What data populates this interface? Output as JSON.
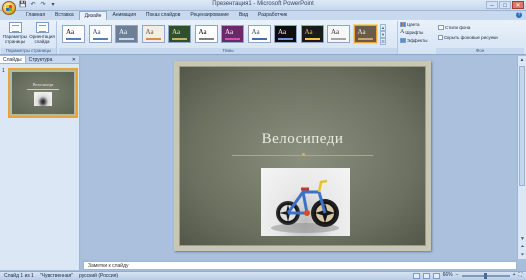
{
  "app": {
    "title": "Презентация1 - Microsoft PowerPoint",
    "window_controls": [
      "–",
      "□",
      "✕"
    ]
  },
  "quick_access": [
    "💾",
    "↶",
    "↷",
    "▾"
  ],
  "ribbon": {
    "tabs": [
      "Главная",
      "Вставка",
      "Дизайн",
      "Анимация",
      "Показ слайдов",
      "Рецензирование",
      "Вид",
      "Разработчик"
    ],
    "active_tab": "Дизайн",
    "page_setup": {
      "group_label": "Параметры страницы",
      "buttons": [
        "Параметры страницы",
        "Ориентация слайда"
      ]
    },
    "themes": {
      "group_label": "Темы",
      "items": [
        {
          "label": "Aa",
          "bg": "#ffffff",
          "fg": "#000000",
          "bars": "#4f81bd"
        },
        {
          "label": "Aa",
          "bg": "#ffffff",
          "fg": "#1f497d",
          "bars": "#4f81bd"
        },
        {
          "label": "Aa",
          "bg": "#6d7f97",
          "fg": "#ffffff",
          "bars": "#c9d6e5"
        },
        {
          "label": "Aa",
          "bg": "#f2eee4",
          "fg": "#7b4d2e",
          "bars": "#d58f4a"
        },
        {
          "label": "Aa",
          "bg": "#2f4f2f",
          "fg": "#f0e6b0",
          "bars": "#c9b25a"
        },
        {
          "label": "Aa",
          "bg": "#ffffff",
          "fg": "#000000",
          "bars": "#7f7f7f"
        },
        {
          "label": "Aa",
          "bg": "#6a2a6a",
          "fg": "#ffffff",
          "bars": "#d04fb0"
        },
        {
          "label": "Aa",
          "bg": "#ffffff",
          "fg": "#2c4b70",
          "bars": "#3b6eb0"
        },
        {
          "label": "Aa",
          "bg": "#0d0d0d",
          "fg": "#ffffff",
          "bars": "#6a9be0"
        },
        {
          "label": "Aa",
          "bg": "#1a1a1a",
          "fg": "#f6c24a",
          "bars": "#f6c24a"
        },
        {
          "label": "Aa",
          "bg": "#f7f7f7",
          "fg": "#2c2c2c",
          "bars": "#a5a5a5"
        },
        {
          "label": "Aa",
          "bg": "#6b5a48",
          "fg": "#f3ead8",
          "bars": "#c9a46a"
        }
      ],
      "selected_index": 11
    },
    "theme_cmds": [
      "Цвета",
      "Шрифты",
      "Эффекты"
    ],
    "background": {
      "group_label": "Фон",
      "styles_label": "Стили фона",
      "hide_graphics_label": "Скрыть фоновые рисунки"
    }
  },
  "left_pane": {
    "tabs": [
      "Слайды",
      "Структура"
    ],
    "active_tab": "Слайды",
    "close_label": "✕",
    "slides": [
      {
        "number": "1",
        "title": "Велосипеди"
      }
    ]
  },
  "slide": {
    "title": "Велосипеди"
  },
  "notes": {
    "placeholder": "Заметки к слайду"
  },
  "status": {
    "slide_info": "Слайд 1 из 1",
    "theme": "\"Чувственная\"",
    "language": "русский (Россия)",
    "zoom": "66%"
  }
}
